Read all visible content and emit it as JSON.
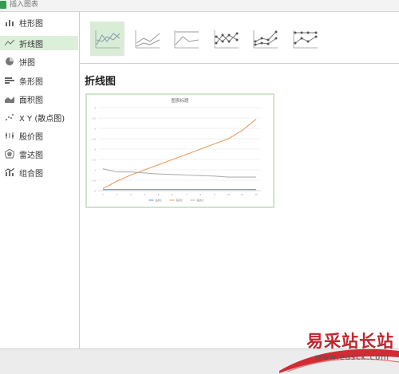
{
  "window": {
    "title": "插入图表"
  },
  "sidebar": {
    "items": [
      {
        "label": "柱形图",
        "icon": "column-chart-icon"
      },
      {
        "label": "折线图",
        "icon": "line-chart-icon",
        "active": true
      },
      {
        "label": "饼图",
        "icon": "pie-chart-icon"
      },
      {
        "label": "条形图",
        "icon": "bar-chart-icon"
      },
      {
        "label": "面积图",
        "icon": "area-chart-icon"
      },
      {
        "label": "X Y (散点图)",
        "icon": "scatter-chart-icon"
      },
      {
        "label": "股价图",
        "icon": "stock-chart-icon"
      },
      {
        "label": "雷达图",
        "icon": "radar-chart-icon"
      },
      {
        "label": "组合图",
        "icon": "combo-chart-icon"
      }
    ]
  },
  "main": {
    "section_title": "折线图",
    "variants": [
      {
        "name": "line",
        "selected": true
      },
      {
        "name": "stacked-line"
      },
      {
        "name": "100-stacked-line"
      },
      {
        "name": "line-with-markers"
      },
      {
        "name": "stacked-line-with-markers"
      },
      {
        "name": "100-stacked-line-with-markers"
      }
    ]
  },
  "chart_data": {
    "type": "line",
    "title": "图表标题",
    "x": [
      1,
      2,
      3,
      4,
      5,
      6,
      7,
      8,
      9,
      10,
      11,
      12
    ],
    "series": [
      {
        "name": "系列1",
        "color": "#5b9bd5",
        "values": [
          0.1,
          0.1,
          0.1,
          0.1,
          0.1,
          0.1,
          0.1,
          0.1,
          0.1,
          0.1,
          0.1,
          0.1
        ]
      },
      {
        "name": "系列2",
        "color": "#ed9a5e",
        "values": [
          0.2,
          0.9,
          1.5,
          2.0,
          2.5,
          3.0,
          3.5,
          4.0,
          4.5,
          5.0,
          5.8,
          6.9
        ]
      },
      {
        "name": "系列3",
        "color": "#b0b0b0",
        "values": [
          2.1,
          1.8,
          1.8,
          1.7,
          1.6,
          1.55,
          1.5,
          1.45,
          1.4,
          1.3,
          1.3,
          1.3
        ]
      }
    ],
    "ylim": [
      0,
      8
    ],
    "yticks": [
      0,
      0.5,
      1,
      1.5,
      2,
      2.5,
      3,
      3.5,
      4
    ],
    "legend": "bottom",
    "grid": true
  },
  "watermark": {
    "text": "易采站长站",
    "url": "www.easck.com"
  },
  "colors": {
    "accent_green": "#2e9e4f",
    "selected_bg": "#dcefd9",
    "orange": "#ed9a5e",
    "gray": "#b0b0b0",
    "blue": "#5b9bd5"
  }
}
